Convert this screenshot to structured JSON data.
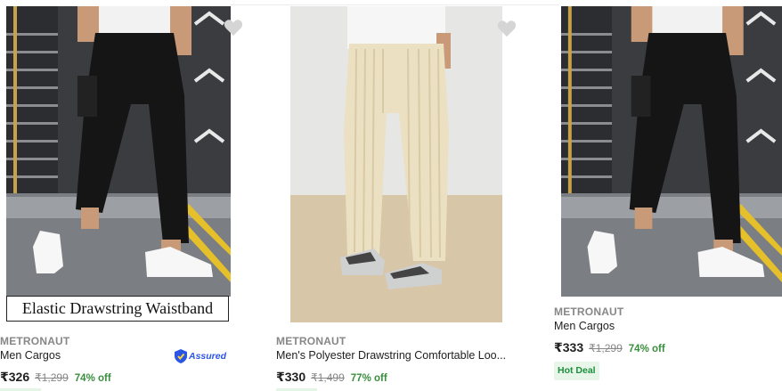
{
  "products": [
    {
      "brand": "METRONAUT",
      "title": "Men Cargos",
      "price": "₹326",
      "mrp": "₹1,299",
      "discount": "74% off",
      "image_caption": "Elastic Drawstring Waistband",
      "assured_label": "Assured",
      "image_desc": "black-cargo-pants-model"
    },
    {
      "brand": "METRONAUT",
      "title": "Men's Polyester Drawstring Comfortable Loo...",
      "price": "₹330",
      "mrp": "₹1,499",
      "discount": "77% off",
      "image_desc": "beige-corduroy-pants-model"
    },
    {
      "brand": "METRONAUT",
      "title": "Men Cargos",
      "price": "₹333",
      "mrp": "₹1,299",
      "discount": "74% off",
      "badge": "Hot Deal",
      "image_desc": "black-cargo-pants-model"
    }
  ],
  "colors": {
    "brand_gray": "#878787",
    "discount_green": "#388e3c",
    "assured_blue": "#2a55e5",
    "hot_deal_bg": "#e8f6ea",
    "hot_deal_text": "#1c8f3b"
  },
  "icons": [
    "heart-icon",
    "assured-shield-icon"
  ]
}
